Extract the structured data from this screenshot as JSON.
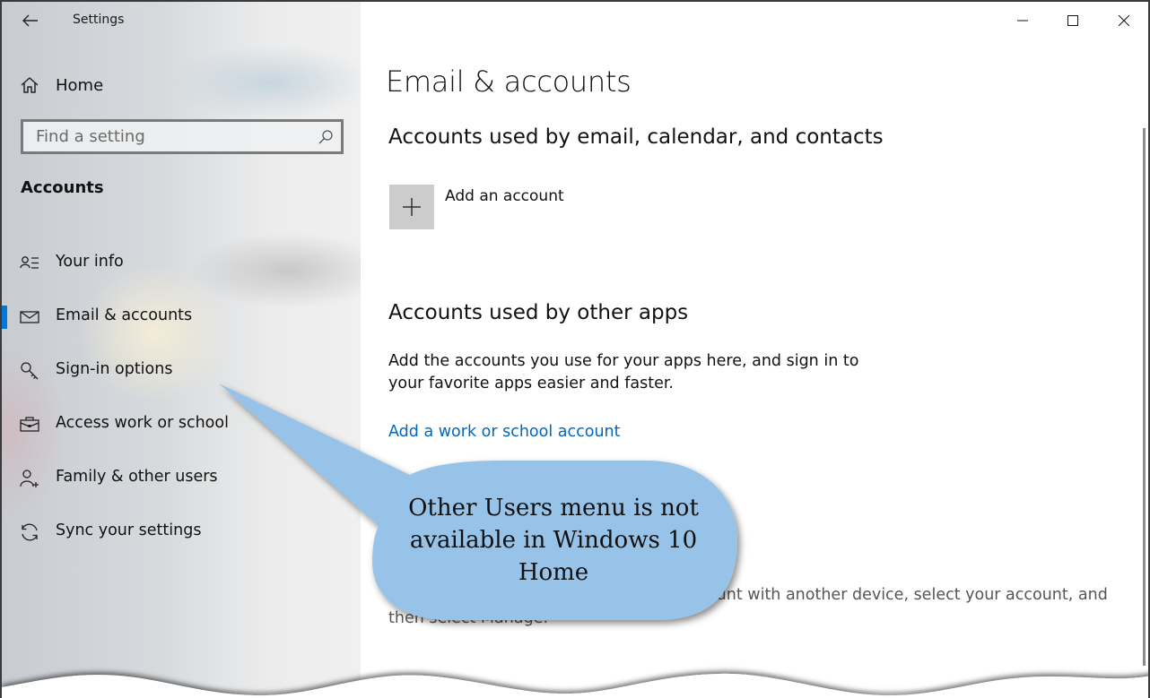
{
  "window": {
    "app_title": "Settings",
    "back_icon": "back-arrow-icon",
    "caption_buttons": [
      "minimize",
      "maximize",
      "close"
    ]
  },
  "sidebar": {
    "home_label": "Home",
    "home_icon": "home-icon",
    "search_placeholder": "Find a setting",
    "search_value": "",
    "search_icon": "search-icon",
    "section_label": "Accounts",
    "items": [
      {
        "label": "Your info",
        "icon": "contact-info-icon",
        "active": false
      },
      {
        "label": "Email & accounts",
        "icon": "mail-icon",
        "active": true
      },
      {
        "label": "Sign-in options",
        "icon": "key-icon",
        "active": false
      },
      {
        "label": "Access work or school",
        "icon": "briefcase-icon",
        "active": false
      },
      {
        "label": "Family & other users",
        "icon": "add-person-icon",
        "active": false
      },
      {
        "label": "Sync your settings",
        "icon": "sync-icon",
        "active": false
      }
    ],
    "accent_color": "#0078d7"
  },
  "main": {
    "page_title": "Email & accounts",
    "section1": {
      "heading": "Accounts used by email, calendar, and contacts",
      "add_label": "Add an account",
      "add_icon": "plus-icon"
    },
    "section2": {
      "heading": "Accounts used by other apps",
      "description": "Add the accounts you use for your apps here, and sign in to your favorite apps easier and faster.",
      "link": "Add a work or school account",
      "link_color": "#0067c0"
    },
    "section3": {
      "description": "To stop using an account, or sync an account with another device, select your account, and then select Manage."
    }
  },
  "annotation": {
    "callout_text": "Other Users menu is not available in Windows 10 Home",
    "callout_color": "#97c3e8"
  }
}
